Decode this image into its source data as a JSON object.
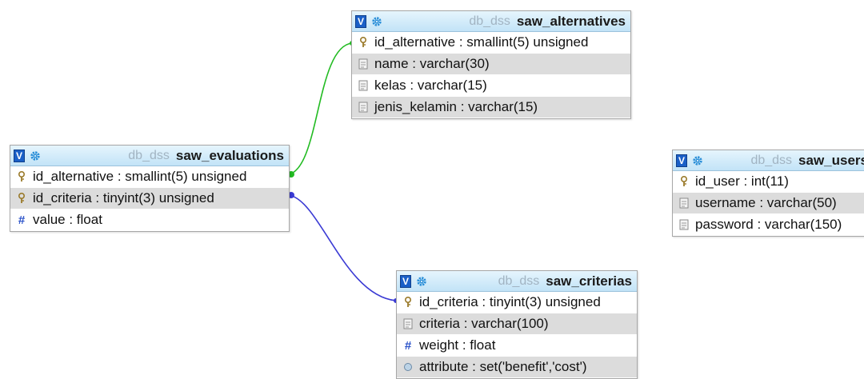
{
  "tables": {
    "saw_alternatives": {
      "db": "db_dss",
      "name": "saw_alternatives",
      "columns": [
        {
          "text": "id_alternative : smallint(5) unsigned",
          "icon": "key-icon"
        },
        {
          "text": "name : varchar(30)",
          "icon": "text-field-icon"
        },
        {
          "text": "kelas : varchar(15)",
          "icon": "text-field-icon"
        },
        {
          "text": "jenis_kelamin : varchar(15)",
          "icon": "text-field-icon"
        }
      ]
    },
    "saw_evaluations": {
      "db": "db_dss",
      "name": "saw_evaluations",
      "columns": [
        {
          "text": "id_alternative : smallint(5) unsigned",
          "icon": "key-icon"
        },
        {
          "text": "id_criteria : tinyint(3) unsigned",
          "icon": "key-icon"
        },
        {
          "text": "value : float",
          "icon": "number-icon"
        }
      ]
    },
    "saw_users": {
      "db": "db_dss",
      "name": "saw_users",
      "columns": [
        {
          "text": "id_user : int(11)",
          "icon": "key-icon"
        },
        {
          "text": "username : varchar(50)",
          "icon": "text-field-icon"
        },
        {
          "text": "password : varchar(150)",
          "icon": "text-field-icon"
        }
      ]
    },
    "saw_criterias": {
      "db": "db_dss",
      "name": "saw_criterias",
      "columns": [
        {
          "text": "id_criteria : tinyint(3) unsigned",
          "icon": "key-icon"
        },
        {
          "text": "criteria : varchar(100)",
          "icon": "text-field-icon"
        },
        {
          "text": "weight : float",
          "icon": "number-icon"
        },
        {
          "text": "attribute : set('benefit','cost')",
          "icon": "set-icon"
        }
      ]
    }
  },
  "toggle_label": "V",
  "colors": {
    "relation_alternatives": "#22bb22",
    "relation_criterias": "#3a3ad4",
    "header": "#c2e3f7",
    "row_alt": "#dcdcdc"
  }
}
